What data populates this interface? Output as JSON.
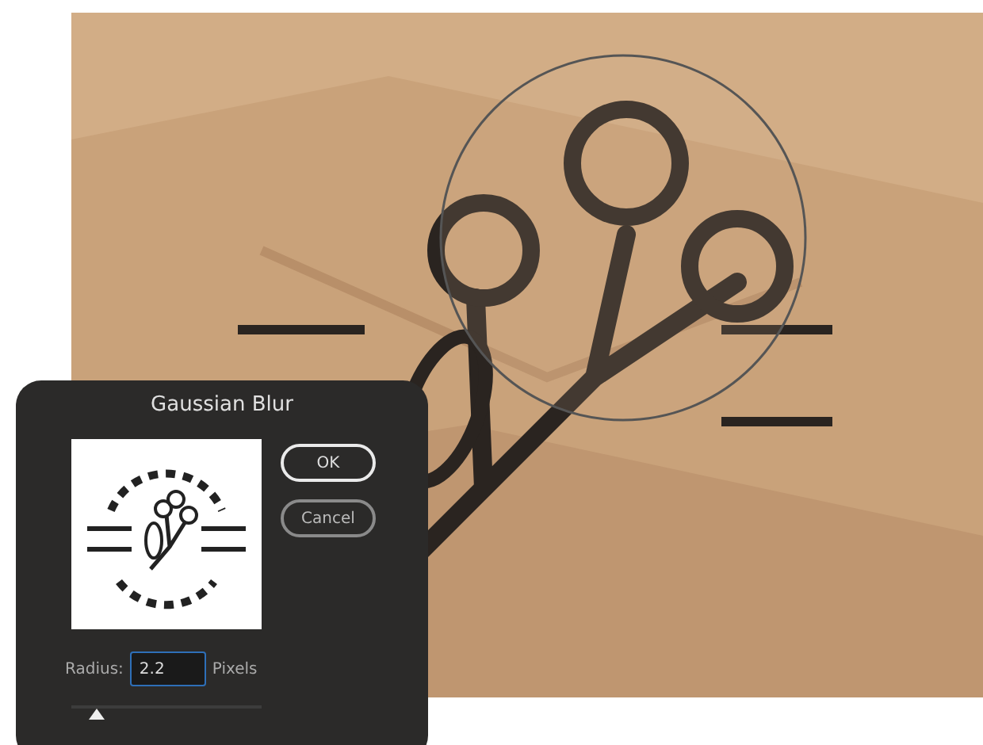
{
  "dialog": {
    "title": "Gaussian Blur",
    "buttons": [
      {
        "label": "OK",
        "default": true
      },
      {
        "label": "Cancel",
        "default": false
      }
    ],
    "radius": {
      "label": "Radius:",
      "value": "2.2",
      "unit": "Pixels",
      "level": 0.13
    }
  }
}
